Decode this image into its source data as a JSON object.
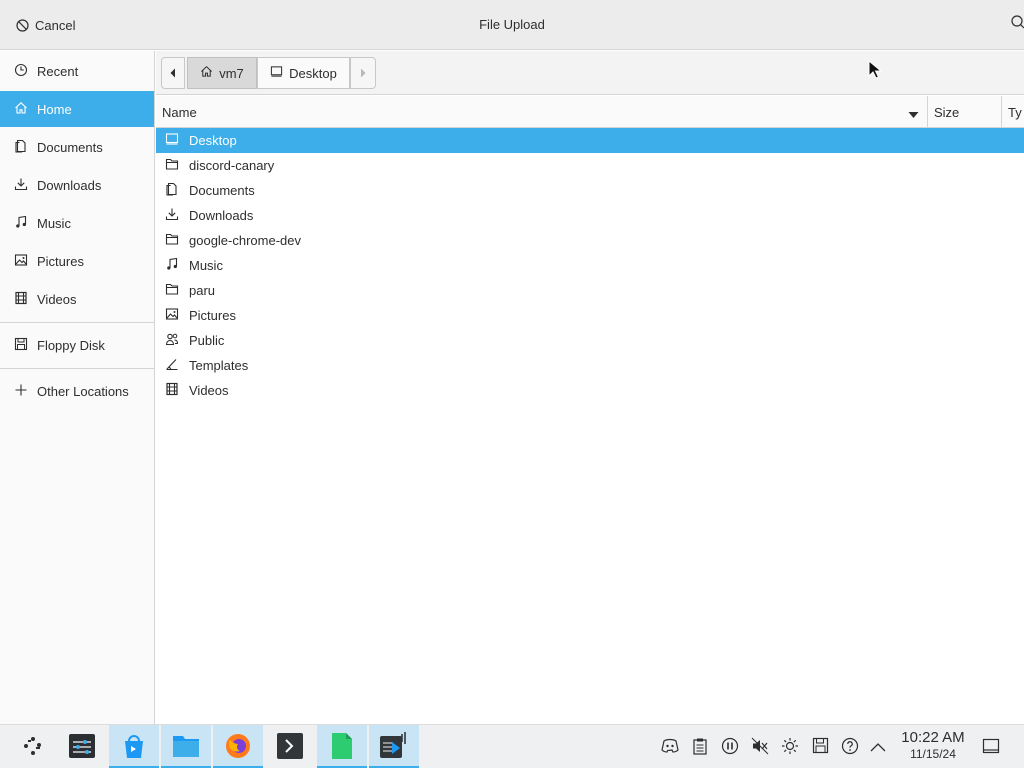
{
  "header": {
    "cancel_label": "Cancel",
    "title": "File Upload"
  },
  "sidebar": {
    "items": [
      {
        "label": "Recent",
        "icon": "clock-icon"
      },
      {
        "label": "Home",
        "icon": "home-icon",
        "active": true
      },
      {
        "label": "Documents",
        "icon": "documents-icon"
      },
      {
        "label": "Downloads",
        "icon": "download-icon"
      },
      {
        "label": "Music",
        "icon": "music-icon"
      },
      {
        "label": "Pictures",
        "icon": "pictures-icon"
      },
      {
        "label": "Videos",
        "icon": "videos-icon"
      }
    ],
    "devices": [
      {
        "label": "Floppy Disk",
        "icon": "floppy-icon"
      }
    ],
    "other": [
      {
        "label": "Other Locations",
        "icon": "plus-icon"
      }
    ]
  },
  "pathbar": {
    "segments": [
      "vm7",
      "Desktop"
    ]
  },
  "columns": {
    "name": "Name",
    "size": "Size",
    "type": "Ty"
  },
  "files": [
    {
      "name": "Desktop",
      "icon": "desktop-icon",
      "selected": true
    },
    {
      "name": "discord-canary",
      "icon": "folder-icon"
    },
    {
      "name": "Documents",
      "icon": "documents-icon"
    },
    {
      "name": "Downloads",
      "icon": "download-icon"
    },
    {
      "name": "google-chrome-dev",
      "icon": "folder-icon"
    },
    {
      "name": "Music",
      "icon": "music-icon"
    },
    {
      "name": "paru",
      "icon": "folder-icon"
    },
    {
      "name": "Pictures",
      "icon": "pictures-icon"
    },
    {
      "name": "Public",
      "icon": "users-icon"
    },
    {
      "name": "Templates",
      "icon": "templates-icon"
    },
    {
      "name": "Videos",
      "icon": "videos-icon"
    }
  ],
  "taskbar": {
    "apps": [
      "app-launcher-icon",
      "system-settings-icon",
      "discover-icon",
      "dolphin-icon",
      "firefox-icon",
      "terminal-icon",
      "libreoffice-icon",
      "media-player-icon"
    ],
    "tray": [
      "discord-tray-icon",
      "clipboard-icon",
      "pause-icon",
      "muted-speaker-icon",
      "brightness-icon",
      "save-icon",
      "help-icon",
      "chevron-up-icon"
    ],
    "time": "10:22 AM",
    "date": "11/15/24"
  },
  "colors": {
    "accent": "#3daee9",
    "header_bg": "#ececec",
    "sidebar_bg": "#fafafa",
    "taskbar_bg": "#eef0f1"
  }
}
